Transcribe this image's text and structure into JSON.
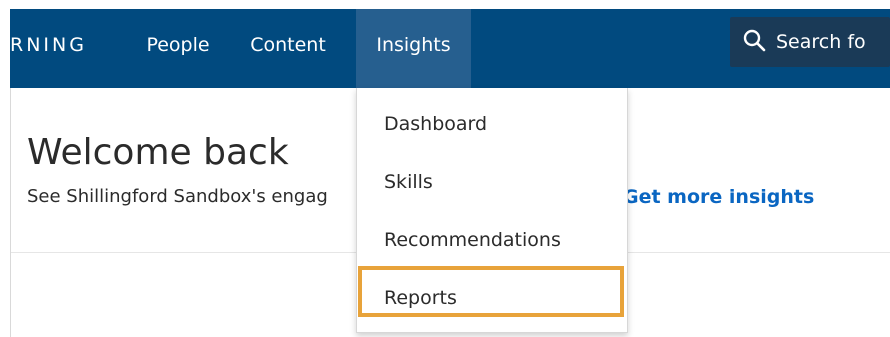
{
  "nav": {
    "brand": "RNING",
    "items": [
      "People",
      "Content",
      "Insights"
    ],
    "active": "Insights",
    "search_placeholder": "Search fo"
  },
  "main": {
    "welcome": "Welcome back",
    "subtitle": "See Shillingford Sandbox's engag",
    "more_link": "Get more insights"
  },
  "dropdown": {
    "items": [
      "Dashboard",
      "Skills",
      "Recommendations",
      "Reports"
    ],
    "highlighted": "Reports"
  },
  "colors": {
    "nav_bg": "#014a7f",
    "nav_active_bg": "#265f8f",
    "link": "#0a66c2",
    "highlight": "#e8a33a"
  }
}
